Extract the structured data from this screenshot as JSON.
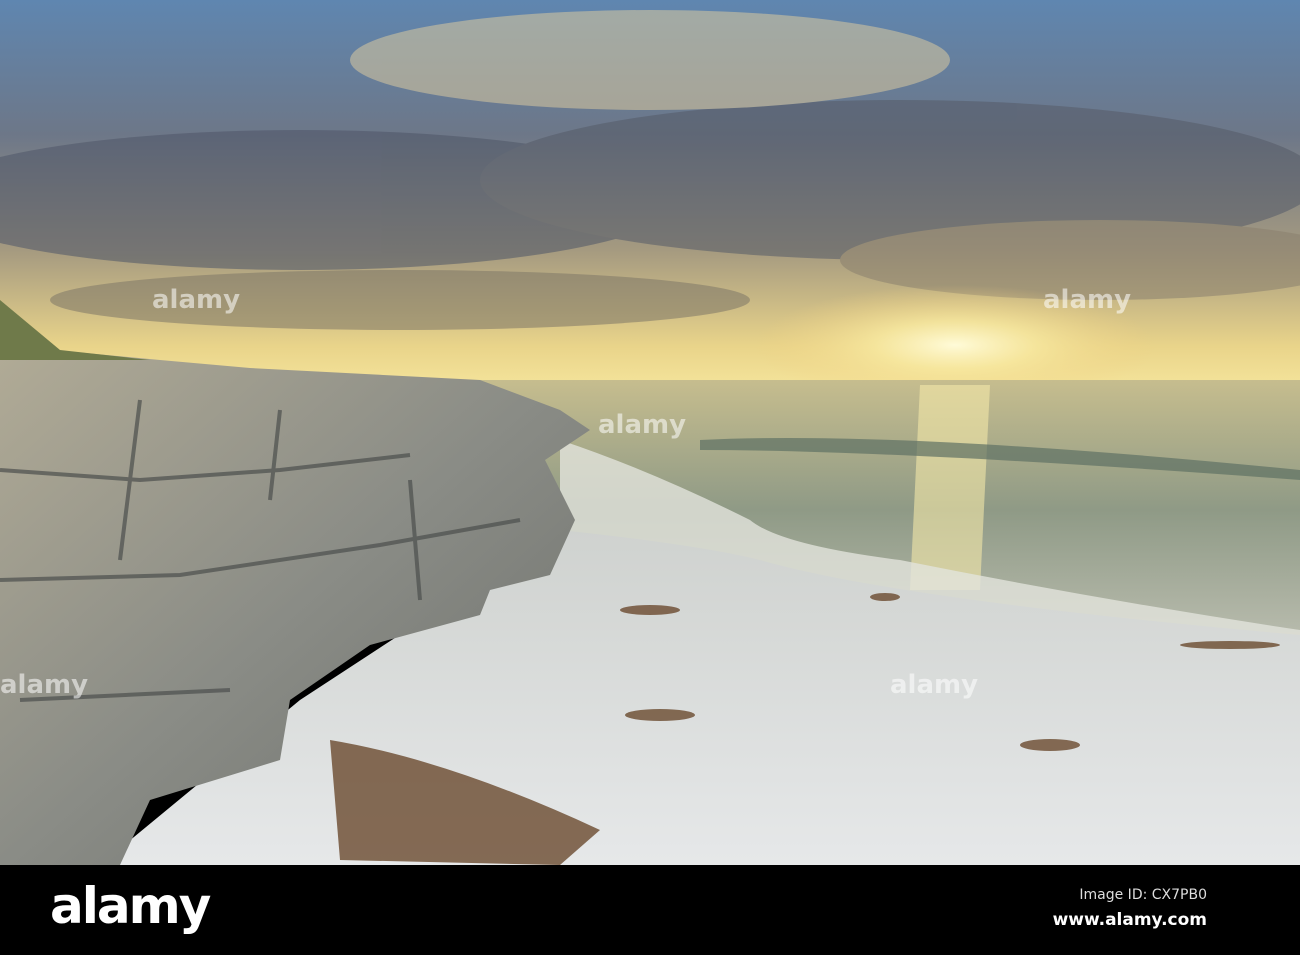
{
  "photo": {
    "subject": "rocky coastline beach at sunset"
  },
  "footer": {
    "logo": "alamy",
    "image_id": "Image ID: CX7PB0",
    "url": "www.alamy.com"
  },
  "watermark": {
    "text": "alamy"
  },
  "colors": {
    "sky_top": "#5f86b0",
    "sun": "#fff4b0",
    "sea": "#b8b18a",
    "sand": "#d9dcdc",
    "rock": "#8c8d88"
  }
}
